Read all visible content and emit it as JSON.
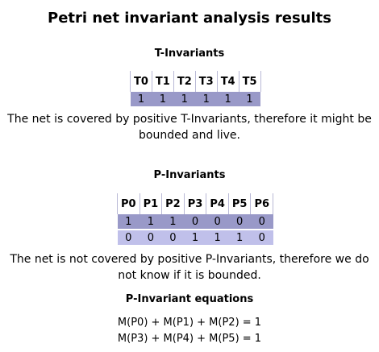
{
  "title": "Petri net invariant analysis results",
  "t_invariants": {
    "heading": "T-Invariants",
    "columns": [
      "T0",
      "T1",
      "T2",
      "T3",
      "T4",
      "T5"
    ],
    "rows": [
      [
        "1",
        "1",
        "1",
        "1",
        "1",
        "1"
      ]
    ],
    "note": "The net is covered by positive T-Invariants, therefore it might be bounded and live."
  },
  "p_invariants": {
    "heading": "P-Invariants",
    "columns": [
      "P0",
      "P1",
      "P2",
      "P3",
      "P4",
      "P5",
      "P6"
    ],
    "rows": [
      [
        "1",
        "1",
        "1",
        "0",
        "0",
        "0",
        "0"
      ],
      [
        "0",
        "0",
        "0",
        "1",
        "1",
        "1",
        "0"
      ]
    ],
    "note": "The net is not covered by positive P-Invariants, therefore we do not know if it is bounded."
  },
  "equations": {
    "heading": "P-Invariant equations",
    "lines": [
      "M(P0) + M(P1) + M(P2) = 1",
      "M(P3) + M(P4) + M(P5) = 1"
    ]
  },
  "colors": {
    "row_primary": "#9999c8",
    "row_secondary": "#c0c0ea",
    "header_divider": "#b9b9d6"
  }
}
